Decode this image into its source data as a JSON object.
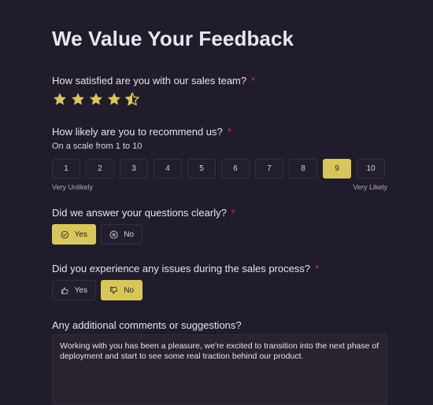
{
  "title": "We Value Your Feedback",
  "q1": {
    "label": "How satisfied are you with our sales team?",
    "required_mark": "*",
    "rating": 4.5,
    "max": 5
  },
  "q2": {
    "label": "How likely are you to recommend us?",
    "required_mark": "*",
    "hint": "On a scale from 1 to 10",
    "options": [
      "1",
      "2",
      "3",
      "4",
      "5",
      "6",
      "7",
      "8",
      "9",
      "10"
    ],
    "selected": "9",
    "low_label": "Very Unlikely",
    "high_label": "Very Likely"
  },
  "q3": {
    "label": "Did we answer your questions clearly?",
    "required_mark": "*",
    "yes_label": "Yes",
    "no_label": "No",
    "selected": "Yes"
  },
  "q4": {
    "label": "Did you experience any issues during the sales process?",
    "required_mark": "*",
    "yes_label": "Yes",
    "no_label": "No",
    "selected": "No"
  },
  "q5": {
    "label": "Any additional comments or suggestions?",
    "value": "Working with you has been a pleasure, we're excited to transition into the next phase of deployment and start to see some real traction behind our product."
  },
  "colors": {
    "background": "#211c2b",
    "accent": "#d8c65a",
    "required": "#d9285a",
    "star": "#d8c65a"
  },
  "icons": {
    "rating": "star-icon",
    "yes": "check-circle-icon",
    "no": "x-circle-icon",
    "issue_yes": "thumbs-up-icon",
    "issue_no": "thumbs-down-icon"
  }
}
